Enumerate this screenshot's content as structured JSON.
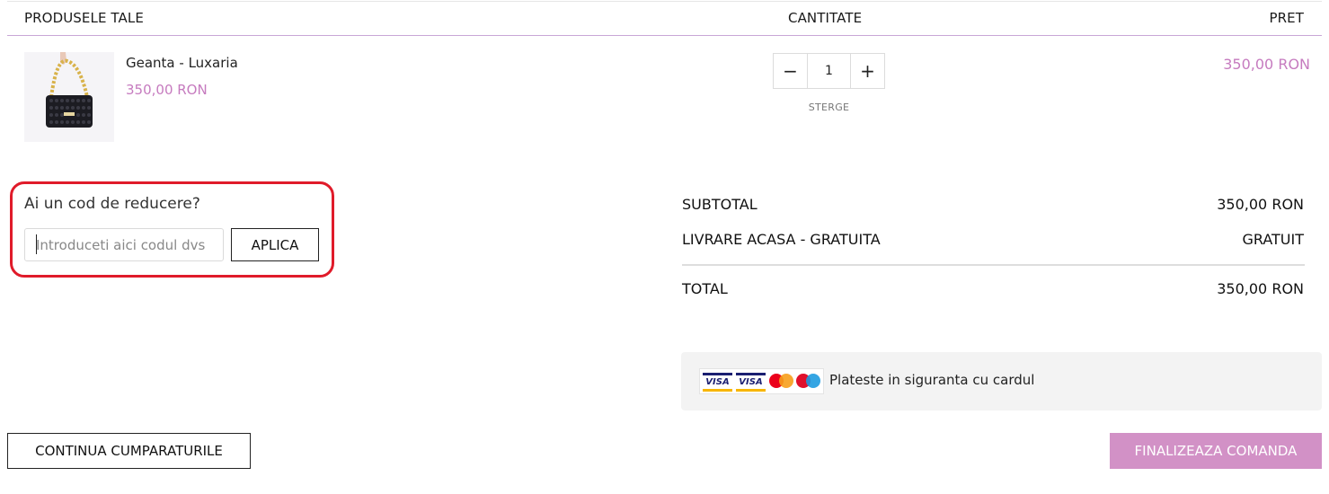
{
  "table_header": {
    "products": "PRODUSELE TALE",
    "quantity": "CANTITATE",
    "price": "PRET"
  },
  "item": {
    "name": "Geanta - Luxaria",
    "price": "350,00 RON",
    "quantity": "1",
    "decrement_symbol": "−",
    "increment_symbol": "+",
    "remove_label": "STERGE",
    "line_total": "350,00 RON"
  },
  "coupon": {
    "title": "Ai un cod de reducere?",
    "placeholder": "Introduceti aici codul dvs",
    "apply_label": "APLICA"
  },
  "totals": {
    "subtotal_label": "SUBTOTAL",
    "subtotal_value": "350,00 RON",
    "shipping_label": "LIVRARE ACASA - GRATUITA",
    "shipping_value": "GRATUIT",
    "total_label": "TOTAL",
    "total_value": "350,00 RON"
  },
  "secure_payment": {
    "text": "Plateste in siguranta cu cardul",
    "card_logos": [
      "visa",
      "visa-electron",
      "mastercard",
      "maestro"
    ],
    "visa_label": "VISA"
  },
  "actions": {
    "continue_label": "CONTINUA CUMPARATURILE",
    "checkout_label": "FINALIZEAZA COMANDA"
  },
  "colors": {
    "accent": "#c67bbf",
    "checkout_bg": "#d291c6",
    "highlight_outline": "#e01b2a"
  }
}
